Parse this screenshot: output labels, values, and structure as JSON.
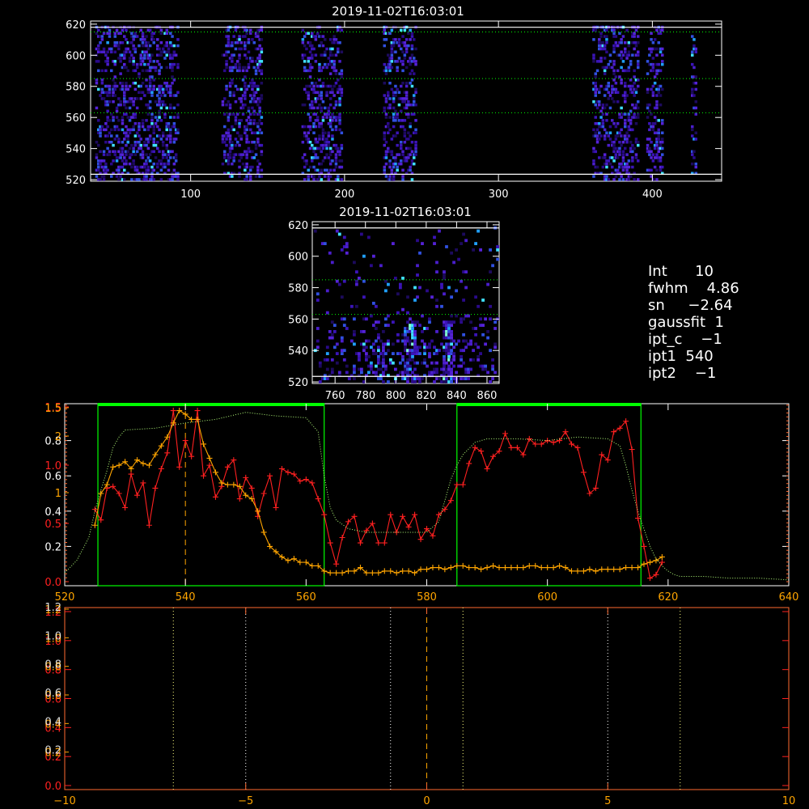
{
  "colors": {
    "background": "#000000",
    "white": "#ffffff",
    "green": "#00ff00",
    "red": "#ff2020",
    "orange": "#ffa500",
    "dotgreen": "#b4ff7a",
    "gridyellow": "#ffff80"
  },
  "info": {
    "lines": [
      "Int      10",
      "fwhm    4.86",
      "sn     −2.64",
      "gaussfit  1",
      "ipt_c    −1",
      "ipt1  540",
      "ipt2    −1"
    ]
  },
  "chart_data": [
    {
      "type": "heatmap",
      "title": "2019-11-02T16:03:01",
      "xlim": [
        35,
        445
      ],
      "ylim": [
        519,
        622
      ],
      "xticks": [
        "100",
        "200",
        "300",
        "400"
      ],
      "xtick_values": [
        100,
        200,
        300,
        400
      ],
      "yticks": [
        "520",
        "540",
        "560",
        "580",
        "600",
        "620"
      ],
      "ytick_values": [
        520,
        540,
        560,
        580,
        600,
        620
      ],
      "column_bands": [
        [
          38,
          92
        ],
        [
          120,
          146
        ],
        [
          172,
          198
        ],
        [
          225,
          246
        ],
        [
          361,
          390
        ],
        [
          396,
          406
        ],
        [
          425,
          428
        ]
      ],
      "hlines_solid": [
        523.5,
        618
      ],
      "hlines_dotted": [
        563,
        585,
        615
      ]
    },
    {
      "type": "heatmap",
      "title": "2019-11-02T16:03:01",
      "xlim": [
        745,
        868
      ],
      "ylim": [
        519,
        622
      ],
      "xticks": [
        "760",
        "780",
        "800",
        "820",
        "840",
        "860"
      ],
      "xtick_values": [
        760,
        780,
        800,
        820,
        840,
        860
      ],
      "yticks": [
        "520",
        "540",
        "560",
        "580",
        "600",
        "620"
      ],
      "ytick_values": [
        520,
        540,
        560,
        580,
        600,
        620
      ],
      "hot_columns": [
        808,
        810,
        833,
        834
      ],
      "hlines_solid": [
        523.5,
        618
      ],
      "hlines_dotted": [
        563,
        585
      ]
    },
    {
      "type": "line",
      "xlim": [
        520,
        640
      ],
      "xticks": [
        "520",
        "540",
        "560",
        "580",
        "600",
        "620",
        "640"
      ],
      "xtick_values": [
        520,
        540,
        560,
        580,
        600,
        620,
        640
      ],
      "ylim": [
        0,
        1.0
      ],
      "yticks_white": [
        "0.2",
        "0.4",
        "0.6",
        "0.8"
      ],
      "ytick_white_values": [
        0.2,
        0.4,
        0.6,
        0.8
      ],
      "yticks_red": [
        "0.0",
        "0.5",
        "1.0",
        "1.5"
      ],
      "ytick_red_values": [
        0.0,
        0.5,
        1.0,
        1.5
      ],
      "yticks_orange": [
        "1",
        "2",
        "1.5"
      ],
      "ytick_orange_values": [
        1.0,
        2.0,
        2.5
      ],
      "green_boxes": [
        [
          525.5,
          563
        ],
        [
          585,
          615.5
        ]
      ],
      "dashed_x": 540,
      "series": [
        {
          "color": "red",
          "x": [
            525,
            526,
            527,
            528,
            529,
            530,
            531,
            532,
            533,
            534,
            535,
            536,
            537,
            538,
            539,
            540,
            541,
            542,
            543,
            544,
            545,
            546,
            547,
            548,
            549,
            550,
            551,
            552,
            553,
            554,
            555,
            556,
            557,
            558,
            559,
            560,
            561,
            562,
            563,
            564,
            565,
            566,
            567,
            568,
            569,
            570,
            571,
            572,
            573,
            574,
            575,
            576,
            577,
            578,
            579,
            580,
            581,
            582,
            583,
            584,
            585,
            586,
            587,
            588,
            589,
            590,
            591,
            592,
            593,
            594,
            595,
            596,
            597,
            598,
            599,
            600,
            601,
            602,
            603,
            604,
            605,
            606,
            607,
            608,
            609,
            610,
            611,
            612,
            613,
            614,
            615,
            616,
            617,
            618,
            619
          ],
          "y": [
            0.41,
            0.35,
            0.53,
            0.54,
            0.5,
            0.42,
            0.61,
            0.49,
            0.56,
            0.32,
            0.53,
            0.64,
            0.73,
            0.97,
            0.65,
            0.8,
            0.71,
            0.97,
            0.6,
            0.66,
            0.48,
            0.54,
            0.65,
            0.69,
            0.47,
            0.59,
            0.53,
            0.37,
            0.5,
            0.6,
            0.42,
            0.64,
            0.62,
            0.61,
            0.57,
            0.58,
            0.56,
            0.47,
            0.38,
            0.22,
            0.1,
            0.25,
            0.34,
            0.37,
            0.22,
            0.29,
            0.33,
            0.22,
            0.22,
            0.38,
            0.28,
            0.37,
            0.31,
            0.38,
            0.24,
            0.3,
            0.26,
            0.38,
            0.41,
            0.46,
            0.55,
            0.55,
            0.67,
            0.76,
            0.74,
            0.64,
            0.71,
            0.74,
            0.84,
            0.76,
            0.76,
            0.72,
            0.81,
            0.78,
            0.78,
            0.8,
            0.79,
            0.8,
            0.85,
            0.78,
            0.76,
            0.62,
            0.5,
            0.53,
            0.72,
            0.69,
            0.85,
            0.87,
            0.91,
            0.75,
            0.36,
            0.2,
            0.02,
            0.04,
            0.11
          ]
        },
        {
          "color": "orange",
          "x": [
            525,
            526,
            527,
            528,
            529,
            530,
            531,
            532,
            533,
            534,
            535,
            536,
            537,
            538,
            539,
            540,
            541,
            542,
            543,
            544,
            545,
            546,
            547,
            548,
            549,
            550,
            551,
            552,
            553,
            554,
            555,
            556,
            557,
            558,
            559,
            560,
            561,
            562,
            563,
            564,
            565,
            566,
            567,
            568,
            569,
            570,
            571,
            572,
            573,
            574,
            575,
            576,
            577,
            578,
            579,
            580,
            581,
            582,
            583,
            584,
            585,
            586,
            587,
            588,
            589,
            590,
            591,
            592,
            593,
            594,
            595,
            596,
            597,
            598,
            599,
            600,
            601,
            602,
            603,
            604,
            605,
            606,
            607,
            608,
            609,
            610,
            611,
            612,
            613,
            614,
            615,
            616,
            617,
            618,
            619
          ],
          "y": [
            0.32,
            0.5,
            0.55,
            0.65,
            0.66,
            0.68,
            0.64,
            0.69,
            0.67,
            0.66,
            0.72,
            0.77,
            0.82,
            0.9,
            0.97,
            0.95,
            0.92,
            0.92,
            0.78,
            0.7,
            0.62,
            0.56,
            0.55,
            0.55,
            0.54,
            0.49,
            0.47,
            0.4,
            0.28,
            0.2,
            0.17,
            0.14,
            0.12,
            0.13,
            0.11,
            0.11,
            0.09,
            0.09,
            0.06,
            0.05,
            0.05,
            0.05,
            0.06,
            0.06,
            0.08,
            0.05,
            0.05,
            0.05,
            0.06,
            0.06,
            0.05,
            0.06,
            0.06,
            0.05,
            0.07,
            0.07,
            0.08,
            0.08,
            0.07,
            0.08,
            0.09,
            0.09,
            0.08,
            0.08,
            0.07,
            0.08,
            0.09,
            0.08,
            0.08,
            0.08,
            0.08,
            0.08,
            0.09,
            0.09,
            0.08,
            0.08,
            0.08,
            0.09,
            0.08,
            0.06,
            0.06,
            0.06,
            0.07,
            0.06,
            0.07,
            0.07,
            0.07,
            0.07,
            0.08,
            0.08,
            0.08,
            0.1,
            0.11,
            0.12,
            0.14
          ]
        },
        {
          "color": "dotgreen",
          "x": [
            520,
            522,
            524,
            525,
            526,
            527,
            528,
            529,
            530,
            535,
            540,
            545,
            550,
            555,
            560,
            562,
            563,
            564,
            565,
            567,
            570,
            575,
            580,
            582,
            583,
            584,
            585,
            586,
            588,
            590,
            595,
            600,
            605,
            610,
            612,
            613,
            614,
            615,
            616,
            617,
            618,
            619,
            620,
            621,
            622,
            624,
            626,
            630,
            635,
            640
          ],
          "y": [
            0.05,
            0.12,
            0.25,
            0.4,
            0.52,
            0.63,
            0.76,
            0.82,
            0.86,
            0.87,
            0.9,
            0.92,
            0.96,
            0.94,
            0.93,
            0.85,
            0.6,
            0.42,
            0.35,
            0.3,
            0.28,
            0.28,
            0.28,
            0.34,
            0.46,
            0.58,
            0.66,
            0.72,
            0.79,
            0.81,
            0.81,
            0.8,
            0.82,
            0.81,
            0.77,
            0.66,
            0.52,
            0.4,
            0.3,
            0.2,
            0.13,
            0.09,
            0.06,
            0.04,
            0.03,
            0.03,
            0.03,
            0.02,
            0.02,
            0.01
          ]
        }
      ]
    },
    {
      "type": "line",
      "xlim": [
        -10,
        10
      ],
      "xticks": [
        "−10",
        "−5",
        "0",
        "5",
        "10"
      ],
      "xtick_values": [
        -10,
        -5,
        0,
        5,
        10
      ],
      "ylim": [
        0,
        1.0
      ],
      "yticks_white": [
        "0.2",
        "0.4",
        "0.6",
        "0.8",
        "1.0",
        "1.2"
      ],
      "ytick_white_values": [
        0.2,
        0.4,
        0.6,
        0.8,
        1.0,
        1.2
      ],
      "yticks_red": [
        "0.0",
        "0.2",
        "0.4",
        "0.6",
        "0.8",
        "1.0",
        "1.2"
      ],
      "ytick_red_values": [
        0.0,
        0.2,
        0.4,
        0.6,
        0.8,
        1.0,
        1.2
      ],
      "yticks_orange": [
        "0.2",
        "0.4",
        "0.6",
        "0.8",
        "1.0",
        "1.2"
      ],
      "ytick_orange_values": [
        0.2,
        0.4,
        0.6,
        0.8,
        1.0,
        1.2
      ],
      "vlines_dotted_yellow": [
        -7,
        1,
        7
      ],
      "vlines_dotted_white": [
        -5,
        -1,
        5
      ],
      "dashed_x": 0
    }
  ]
}
